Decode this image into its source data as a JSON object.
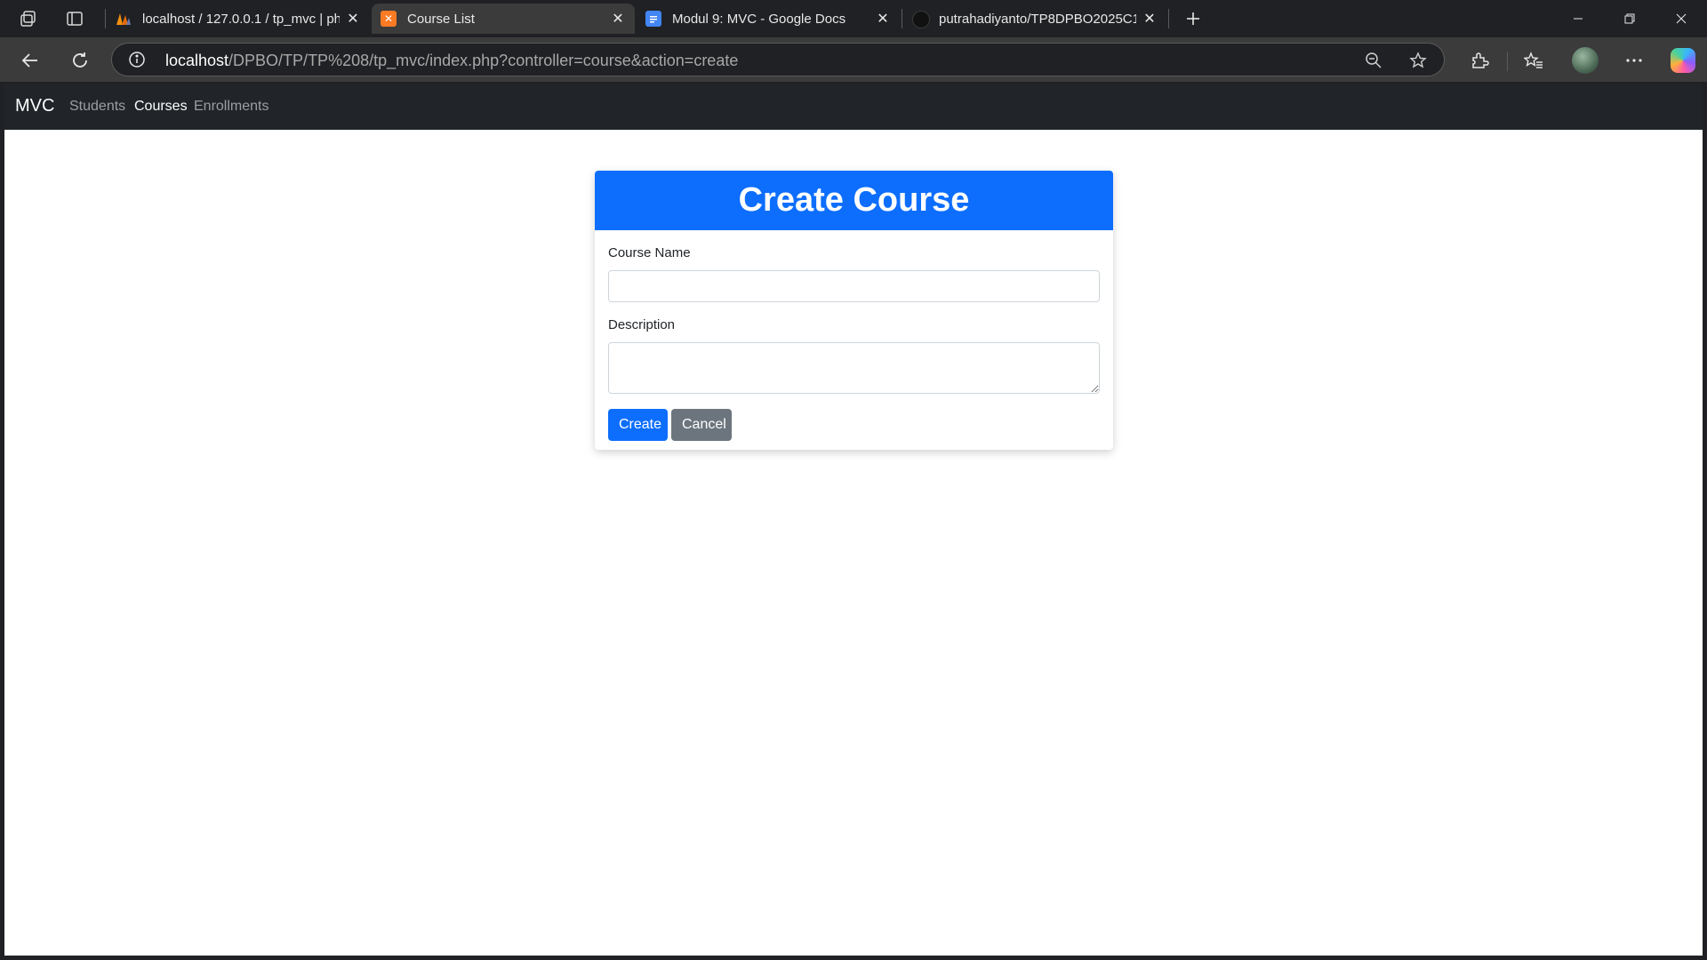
{
  "browser": {
    "tabs": [
      {
        "title": "localhost / 127.0.0.1 / tp_mvc | ph",
        "favicon": "phpmyadmin-icon",
        "active": false
      },
      {
        "title": "Course List",
        "favicon": "xampp-icon",
        "active": true
      },
      {
        "title": "Modul 9: MVC - Google Docs",
        "favicon": "google-docs-icon",
        "active": false
      },
      {
        "title": "putrahadiyanto/TP8DPBO2025C1",
        "favicon": "github-icon",
        "active": false
      }
    ],
    "url_host": "localhost",
    "url_path": "/DPBO/TP/TP%208/tp_mvc/index.php?controller=course&action=create"
  },
  "navbar": {
    "brand": "MVC",
    "links": [
      {
        "label": "Students",
        "active": false
      },
      {
        "label": "Courses",
        "active": true
      },
      {
        "label": "Enrollments",
        "active": false
      }
    ]
  },
  "form": {
    "title": "Create Course",
    "fields": {
      "course_name": {
        "label": "Course Name",
        "value": "",
        "placeholder": ""
      },
      "description": {
        "label": "Description",
        "value": "",
        "placeholder": ""
      }
    },
    "buttons": {
      "create": "Create",
      "cancel": "Cancel"
    }
  },
  "colors": {
    "primary": "#0d6efd",
    "secondary": "#6c757d",
    "navbar_bg": "#212529",
    "browser_chrome": "#202124"
  }
}
